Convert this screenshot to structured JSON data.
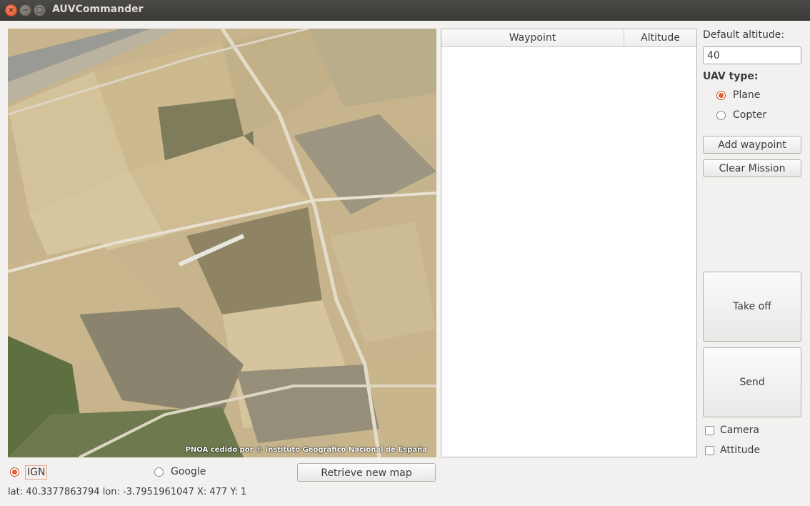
{
  "window": {
    "title": "AUVCommander"
  },
  "map": {
    "credit": "PNOA cedido por © Instituto Geográfico Nacional de España"
  },
  "table": {
    "columns": [
      "Waypoint",
      "Altitude"
    ],
    "rows": []
  },
  "settings": {
    "default_altitude_label": "Default altitude:",
    "default_altitude_value": "40",
    "uav_type_label": "UAV type:",
    "uav_types": [
      {
        "label": "Plane",
        "selected": true
      },
      {
        "label": "Copter",
        "selected": false
      }
    ]
  },
  "buttons": {
    "add_waypoint": "Add waypoint",
    "clear_mission": "Clear Mission",
    "take_off": "Take off",
    "send": "Send",
    "retrieve_map": "Retrieve new map"
  },
  "options": {
    "camera": {
      "label": "Camera",
      "checked": false
    },
    "attitude": {
      "label": "Attitude",
      "checked": false
    }
  },
  "map_source": {
    "options": [
      {
        "label": "IGN",
        "selected": true
      },
      {
        "label": "Google",
        "selected": false
      }
    ]
  },
  "status": {
    "text": "lat: 40.3377863794 lon: -3.7951961047 X: 477 Y: 1"
  },
  "colors": {
    "accent": "#e25f38",
    "titlebar": "#3c3b37",
    "window_bg": "#f2f1f0"
  }
}
